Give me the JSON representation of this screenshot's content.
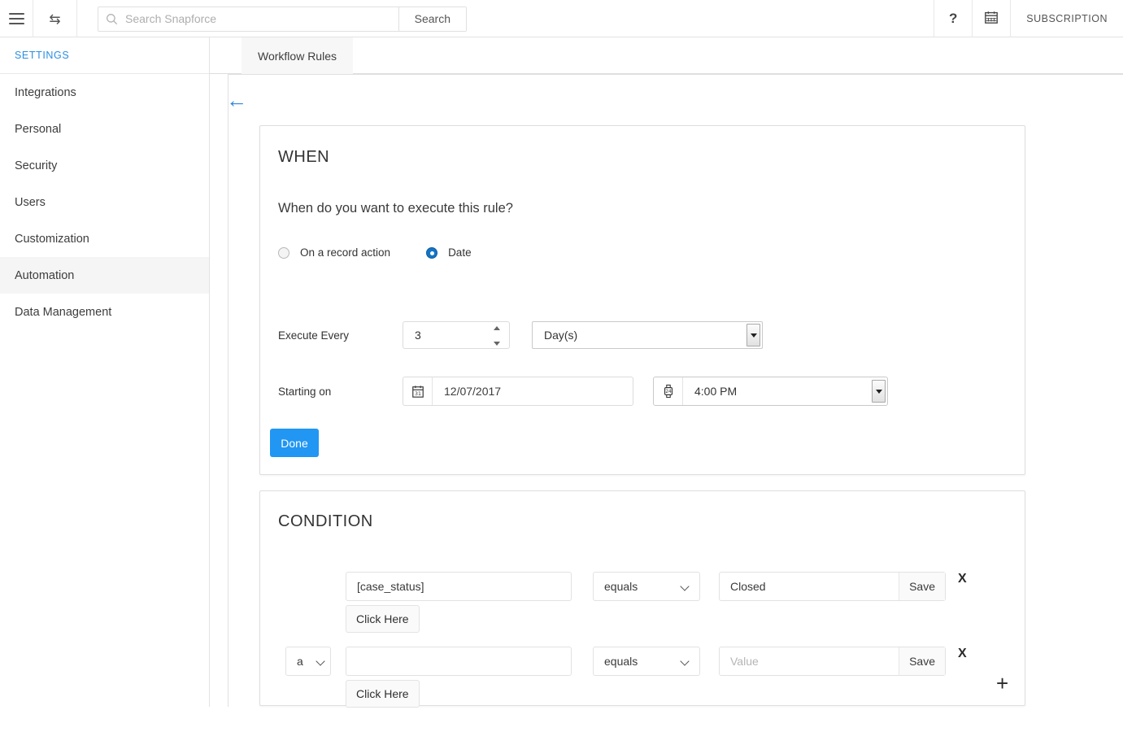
{
  "header": {
    "menu_icon": "hamburger-icon",
    "swap_icon": "transfer-icon",
    "search_placeholder": "Search Snapforce",
    "search_value": "",
    "search_button": "Search",
    "help_icon": "?",
    "calendar_icon": "calendar-icon",
    "subscription_label": "SUBSCRIPTION"
  },
  "sidebar": {
    "heading": "SETTINGS",
    "items": [
      {
        "label": "Integrations",
        "active": false
      },
      {
        "label": "Personal",
        "active": false
      },
      {
        "label": "Security",
        "active": false
      },
      {
        "label": "Users",
        "active": false
      },
      {
        "label": "Customization",
        "active": false
      },
      {
        "label": "Automation",
        "active": true
      },
      {
        "label": "Data Management",
        "active": false
      }
    ]
  },
  "tabs": [
    {
      "label": "Workflow Rules",
      "active": true
    }
  ],
  "back_arrow": "←",
  "when_panel": {
    "title": "WHEN",
    "question": "When do you want to execute this rule?",
    "options": [
      {
        "label": "On a record action",
        "selected": false
      },
      {
        "label": "Date",
        "selected": true
      }
    ],
    "execute_every_label": "Execute Every",
    "execute_every_value": "3",
    "execute_unit_value": "Day(s)",
    "starting_on_label": "Starting on",
    "date_icon": "calendar-31-icon",
    "date_value": "12/07/2017",
    "time_icon": "watch-24-icon",
    "time_value": "4:00 PM",
    "done_label": "Done"
  },
  "condition_panel": {
    "title": "CONDITION",
    "rows": [
      {
        "logic": null,
        "field_value": "[case_status]",
        "field_placeholder": "",
        "operator": "equals",
        "value": "Closed",
        "value_placeholder": "",
        "save_label": "Save",
        "click_here_label": "Click Here",
        "remove_label": "X"
      },
      {
        "logic": "a",
        "field_value": "",
        "field_placeholder": "",
        "operator": "equals",
        "value": "",
        "value_placeholder": "Value",
        "save_label": "Save",
        "click_here_label": "Click Here",
        "remove_label": "X"
      }
    ],
    "add_label": "+"
  },
  "colors": {
    "accent": "#2196f3",
    "link": "#2a8fe0",
    "radio_on": "#1474c4",
    "active_row": "#f5f5f5"
  }
}
